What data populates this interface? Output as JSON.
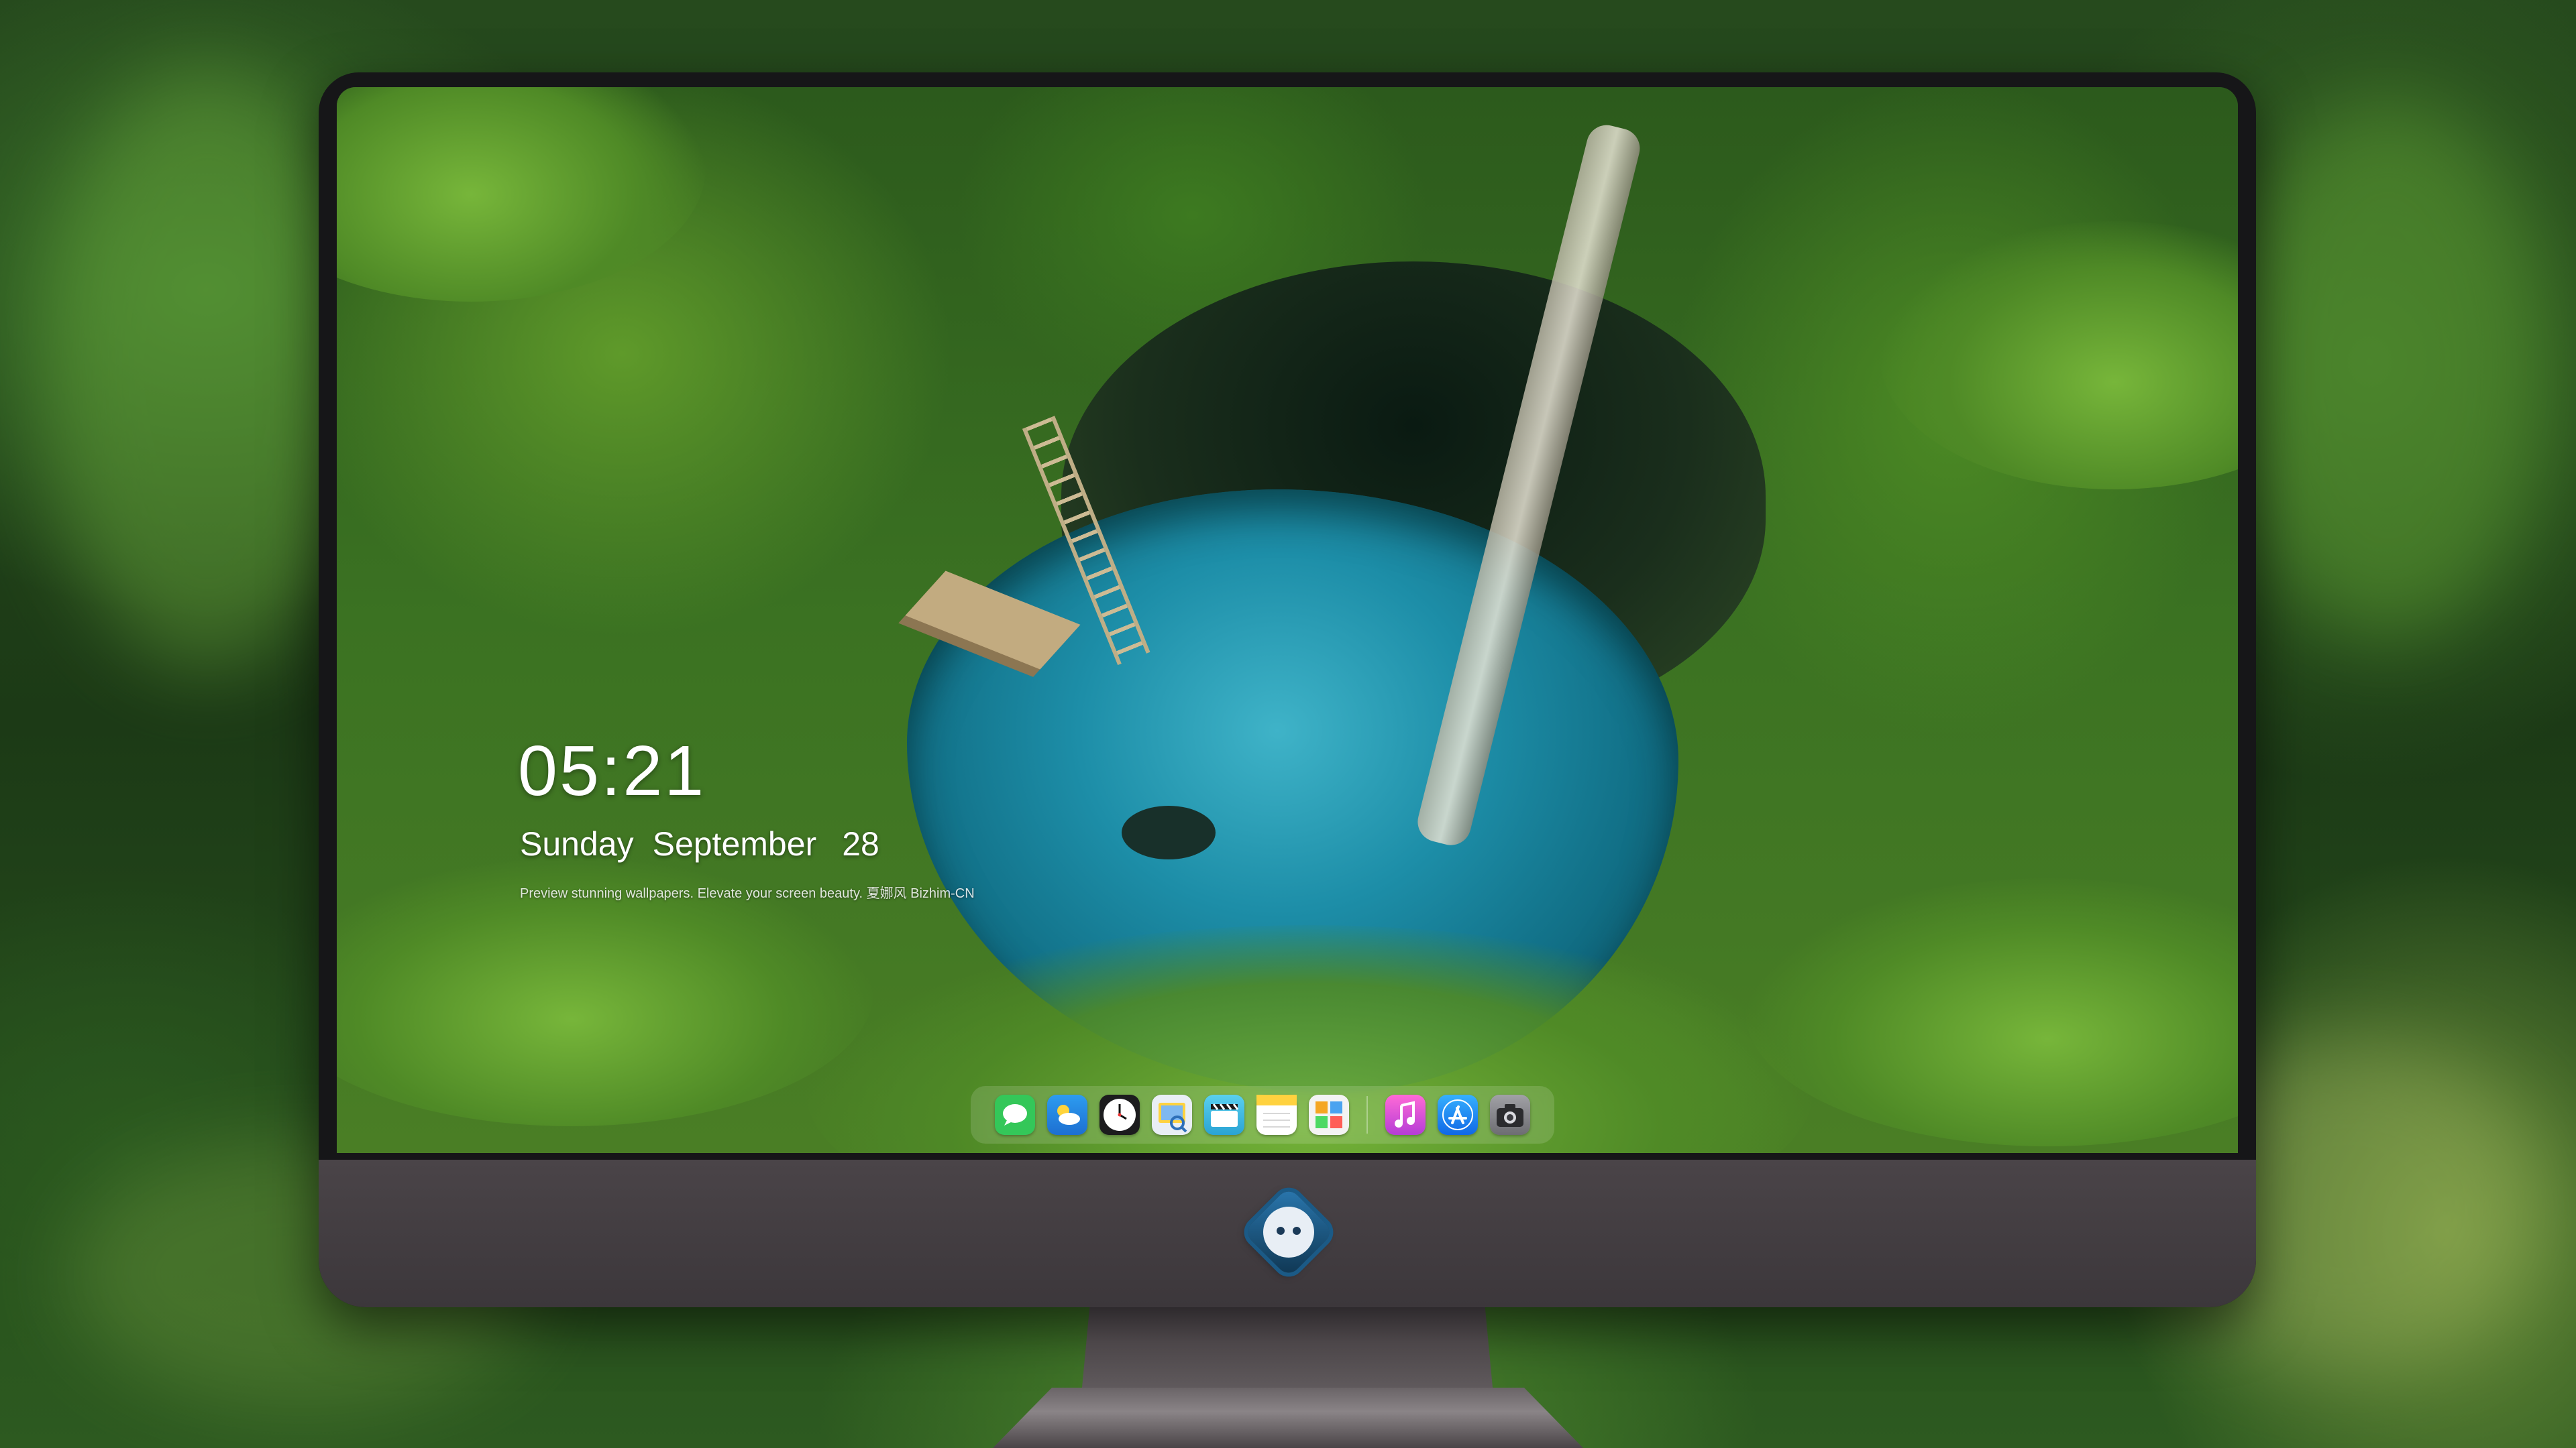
{
  "lockscreen": {
    "time": "05:21",
    "weekday": "Sunday",
    "month": "September",
    "day": "28",
    "tagline": "Preview stunning wallpapers. Elevate your screen beauty. 夏娜风  Bizhim-CN"
  },
  "dock": {
    "apps": [
      {
        "name": "messages-icon",
        "color": "#34c759"
      },
      {
        "name": "weather-icon",
        "color": "#2d9cf0"
      },
      {
        "name": "clock-icon",
        "color": "#1c1c1e"
      },
      {
        "name": "preview-icon",
        "color": "#e9eef5"
      },
      {
        "name": "claquette-icon",
        "color": "#4dc3e8"
      },
      {
        "name": "notes-icon",
        "color": "#ffd23f"
      },
      {
        "name": "photo-collage-icon",
        "color": "#f3f3f3"
      },
      {
        "name": "music-icon",
        "color": "#e546c9"
      },
      {
        "name": "app-store-icon",
        "color": "#1a8cff"
      },
      {
        "name": "camera-icon",
        "color": "#8e8e93"
      }
    ]
  }
}
